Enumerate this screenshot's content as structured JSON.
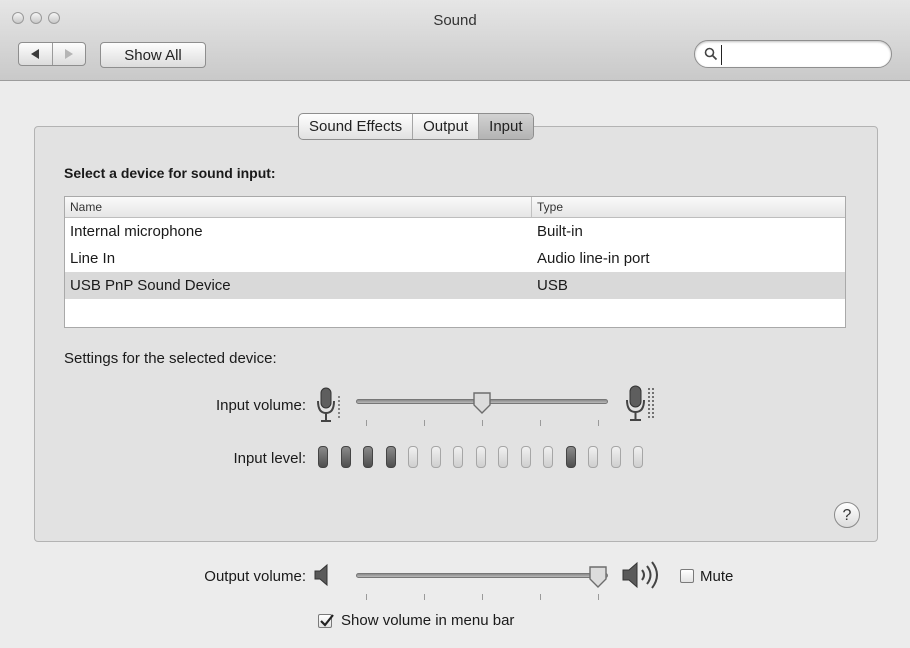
{
  "window": {
    "title": "Sound"
  },
  "toolbar": {
    "show_all_label": "Show All",
    "search_value": "",
    "search_placeholder": ""
  },
  "tabs": [
    {
      "label": "Sound Effects",
      "active": false
    },
    {
      "label": "Output",
      "active": false
    },
    {
      "label": "Input",
      "active": true
    }
  ],
  "input": {
    "section_title": "Select a device for sound input:",
    "table": {
      "columns": [
        "Name",
        "Type"
      ],
      "rows": [
        {
          "name": "Internal microphone",
          "type": "Built-in",
          "selected": false
        },
        {
          "name": "Line In",
          "type": "Audio line-in port",
          "selected": false
        },
        {
          "name": "USB PnP Sound Device",
          "type": "USB",
          "selected": true
        }
      ]
    },
    "settings_title": "Settings for the selected device:",
    "input_volume_label": "Input volume:",
    "input_volume_level": 0.5,
    "input_level_label": "Input level:",
    "input_level_segments": 15,
    "input_level_active": [
      0,
      1,
      2,
      3,
      11
    ]
  },
  "output": {
    "volume_label": "Output volume:",
    "volume_level": 1.0,
    "mute_label": "Mute",
    "mute_checked": false,
    "show_in_menu_bar_label": "Show volume in menu bar",
    "show_in_menu_bar_checked": true
  },
  "help_label": "?",
  "colors": {
    "window_bg": "#ececec",
    "panel_bg": "#e2e2e2",
    "selected_row": "#d9d9d9",
    "active_tab": "#b3b3b3"
  }
}
